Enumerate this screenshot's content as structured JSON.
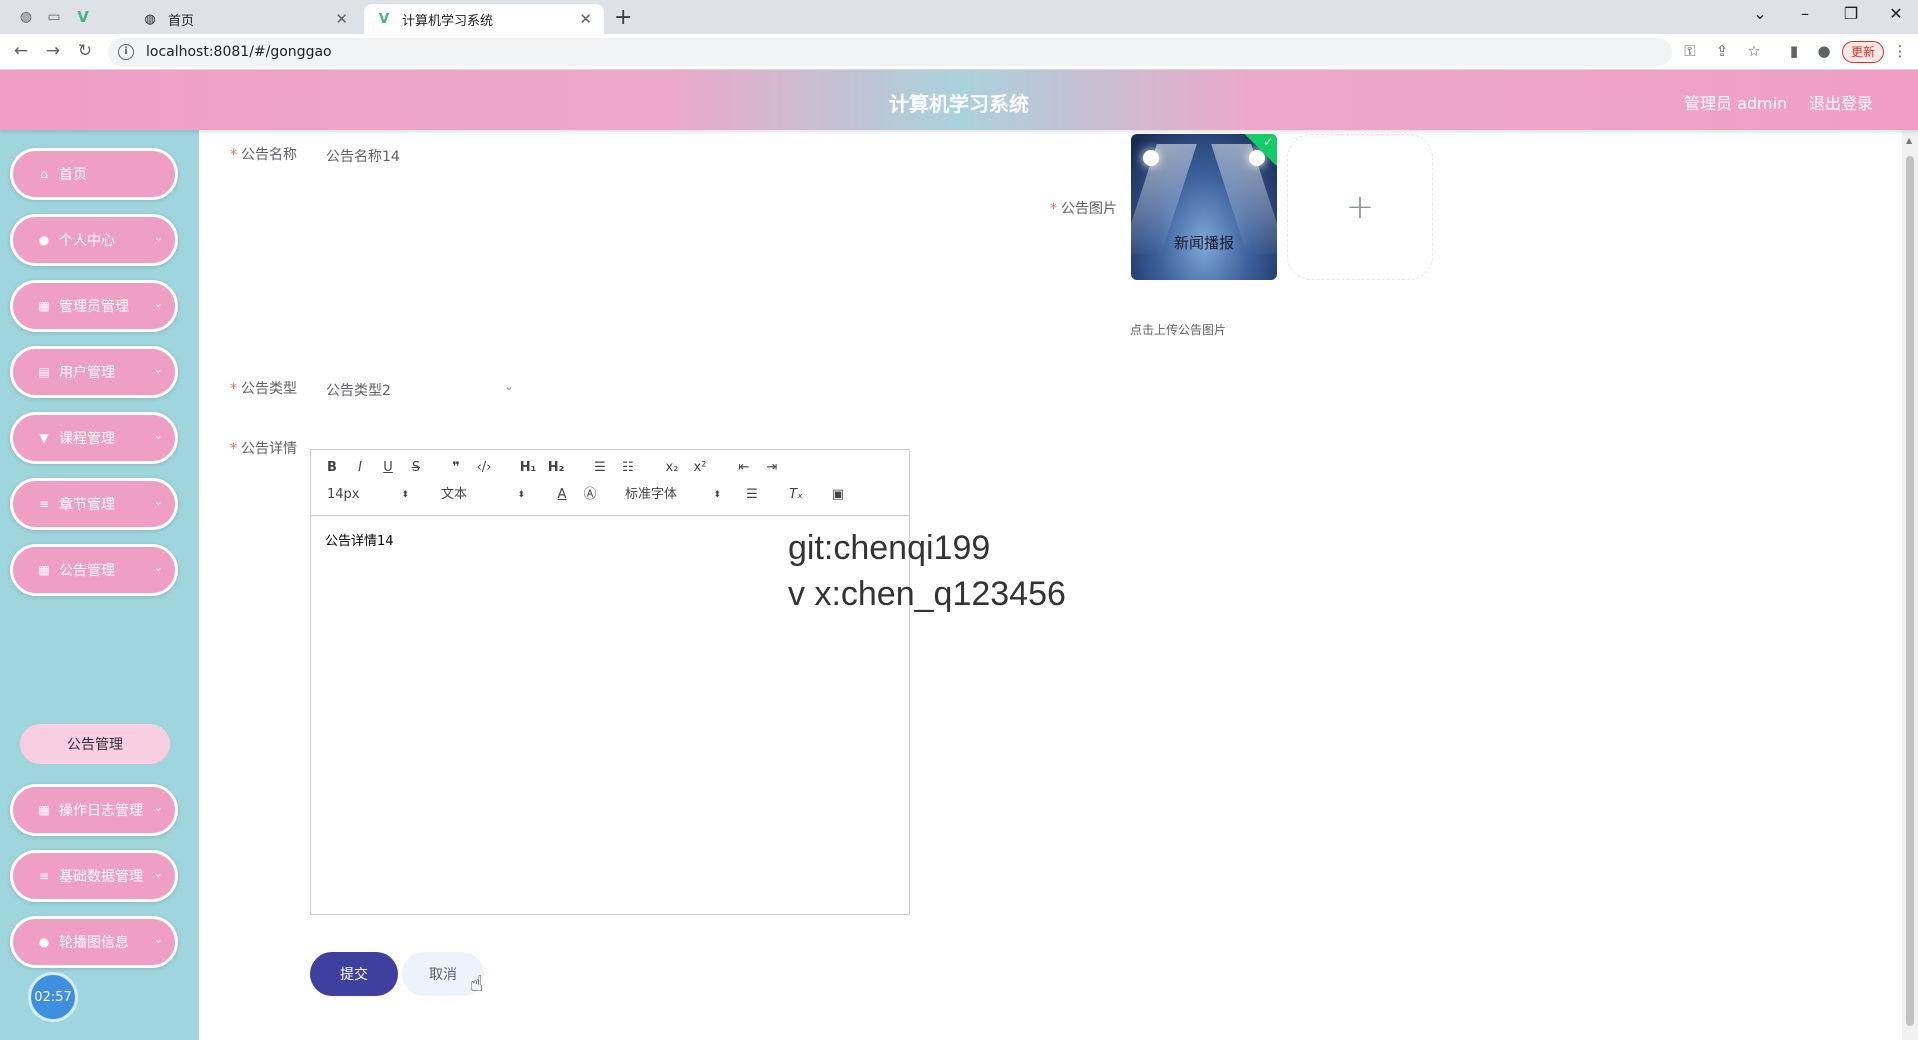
{
  "browser": {
    "tabs": [
      {
        "label": "首页",
        "active": false
      },
      {
        "label": "计算机学习系统",
        "active": true
      }
    ],
    "url": "localhost:8081/#/gonggao",
    "update_label": "更新"
  },
  "header": {
    "title": "计算机学习系统",
    "user": "管理员 admin",
    "logout": "退出登录"
  },
  "sidebar": {
    "items": [
      {
        "label": "首页",
        "icon": "home-icon",
        "expandable": false
      },
      {
        "label": "个人中心",
        "icon": "user-icon",
        "expandable": true
      },
      {
        "label": "管理员管理",
        "icon": "grid-icon",
        "expandable": true
      },
      {
        "label": "用户管理",
        "icon": "clipboard-icon",
        "expandable": true
      },
      {
        "label": "课程管理",
        "icon": "pin-icon",
        "expandable": true
      },
      {
        "label": "章节管理",
        "icon": "list-icon",
        "expandable": true
      },
      {
        "label": "公告管理",
        "icon": "apps-icon",
        "expandable": true
      },
      {
        "label": "操作日志管理",
        "icon": "grid-icon",
        "expandable": true
      },
      {
        "label": "基础数据管理",
        "icon": "list-icon",
        "expandable": true
      },
      {
        "label": "轮播图信息",
        "icon": "bulb-icon",
        "expandable": true
      }
    ],
    "submenu": {
      "label": "公告管理"
    },
    "clock": "02:57"
  },
  "form": {
    "name_label": "公告名称",
    "name_value": "公告名称14",
    "image_label": "公告图片",
    "image_text": "新闻播报",
    "image_tip": "点击上传公告图片",
    "type_label": "公告类型",
    "type_value": "公告类型2",
    "detail_label": "公告详情",
    "detail_value": "公告详情14",
    "submit": "提交",
    "cancel": "取消"
  },
  "editor": {
    "font_size": "14px",
    "header": "文本",
    "font": "标准字体"
  },
  "watermark": {
    "line1": "git:chenqi199",
    "line2": "v x:chen_q123456"
  },
  "colors": {
    "header_pink": "#f19ec3",
    "header_teal": "#a9d2dc",
    "sidebar_bg": "#9fd5dd",
    "menu_pink": "#ef9fc4",
    "submit_blue": "#3f3fa0",
    "required_red": "#f56c6c"
  }
}
